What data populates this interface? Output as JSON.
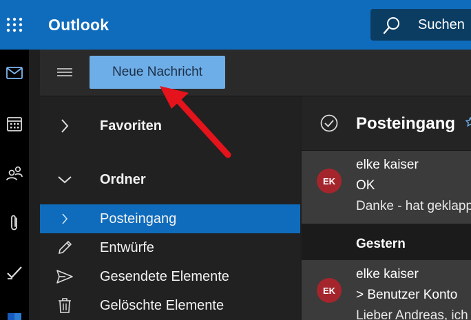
{
  "app": {
    "title": "Outlook"
  },
  "search": {
    "label": "Suchen"
  },
  "rail": {
    "items": [
      "mail-icon",
      "calendar-icon",
      "people-icon",
      "attachment-icon",
      "todo-icon",
      "word-icon"
    ]
  },
  "ribbon": {
    "new_message_label": "Neue Nachricht"
  },
  "folder_pane": {
    "favorites_label": "Favoriten",
    "folders_label": "Ordner",
    "items": [
      {
        "label": "Posteingang",
        "icon": "chevron-right-icon",
        "selected": true
      },
      {
        "label": "Entwürfe",
        "icon": "pencil-icon"
      },
      {
        "label": "Gesendete Elemente",
        "icon": "send-icon"
      },
      {
        "label": "Gelöschte Elemente",
        "icon": "trash-icon"
      }
    ]
  },
  "mail_list": {
    "title": "Posteingang",
    "messages": [
      {
        "initials": "EK",
        "sender": "elke kaiser",
        "subject": "OK",
        "preview": "Danke - hat geklappt"
      },
      {
        "initials": "EK",
        "sender": "elke kaiser",
        "subject": "> Benutzer Konto",
        "preview": "Lieber Andreas, ich"
      }
    ],
    "group_label": "Gestern"
  },
  "colors": {
    "accent": "#0f6cbd",
    "button": "#6eaee8",
    "avatar": "#a4262c",
    "annotation_arrow": "#e5131b"
  }
}
